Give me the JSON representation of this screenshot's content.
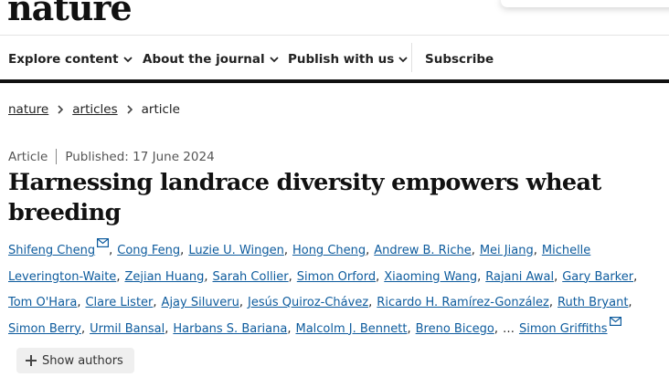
{
  "site": {
    "logo_text": "nature"
  },
  "nav": {
    "items": [
      {
        "label": "Explore content",
        "has_dropdown": true
      },
      {
        "label": "About the journal",
        "has_dropdown": true
      },
      {
        "label": "Publish with us",
        "has_dropdown": true
      },
      {
        "label": "Subscribe",
        "has_dropdown": false
      }
    ]
  },
  "breadcrumb": {
    "items": [
      "nature",
      "articles",
      "article"
    ]
  },
  "article": {
    "type": "Article",
    "published": "Published: 17 June 2024",
    "title": "Harnessing landrace diversity empowers wheat breeding"
  },
  "authors": {
    "lines": [
      [
        "Shifeng Cheng",
        "Cong Feng",
        "Luzie U. Wingen",
        "Hong Cheng",
        "Andrew B. Riche",
        "Mei Jiang",
        "Michelle"
      ],
      [
        "Leverington-Waite",
        "Zejian Huang",
        "Sarah Collier",
        "Simon Orford",
        "Xiaoming Wang",
        "Rajani Awal",
        "Gary Barker"
      ],
      [
        "Tom O'Hara",
        "Clare Lister",
        "Ajay Siluveru",
        "Jesús Quiroz-Chávez",
        "Ricardo H. Ramírez-González",
        "Ruth Bryant"
      ],
      [
        "Simon Berry",
        "Urmil Bansal",
        "Harbans S. Bariana",
        "Malcolm J. Bennett",
        "Breno Bicego"
      ]
    ],
    "ellipsis": "…",
    "last_author": "Simon Griffiths",
    "show_authors_label": "Show authors"
  },
  "colors": {
    "link": "#0d5b9d",
    "text": "#222222",
    "nav_bar": "#111111"
  }
}
